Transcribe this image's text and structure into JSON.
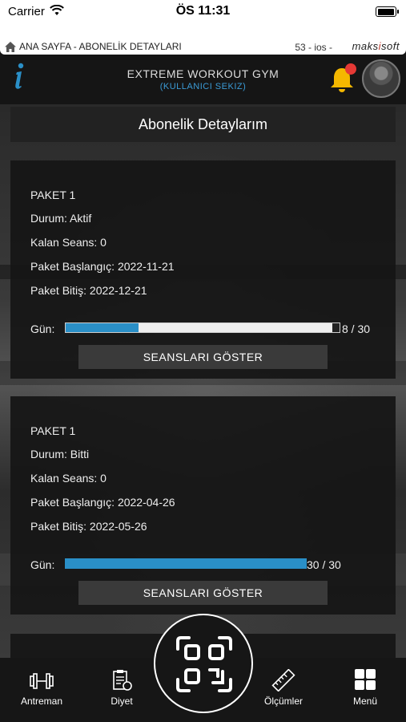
{
  "status_bar": {
    "carrier": "Carrier",
    "time": "ÖS 11:31"
  },
  "header": {
    "breadcrumb": "ANA SAYFA - ABONELİK DETAYLARI",
    "version": "53 - ios -",
    "brand_prefix": "maks",
    "brand_i": "i",
    "brand_suffix": "soft",
    "gym_name": "EXTREME WORKOUT GYM",
    "user_name": "(KULLANICI SEKIZ)"
  },
  "page": {
    "title": "Abonelik Detaylarım"
  },
  "packages": [
    {
      "name": "PAKET 1",
      "status": "Durum: Aktif",
      "remaining": "Kalan Seans: 0",
      "start": "Paket Başlangıç: 2022-11-21",
      "end": "Paket Bitiş: 2022-12-21",
      "gun_label": "Gün:",
      "progress": 0.267,
      "count": "8 / 30",
      "button": "SEANSLARI GÖSTER"
    },
    {
      "name": "PAKET 1",
      "status": "Durum: Bitti",
      "remaining": "Kalan Seans: 0",
      "start": "Paket Başlangıç: 2022-04-26",
      "end": "Paket Bitiş: 2022-05-26",
      "gun_label": "Gün:",
      "progress": 1.0,
      "count": "30 / 30",
      "button": "SEANSLARI GÖSTER"
    }
  ],
  "bottom_nav": {
    "antreman": "Antreman",
    "diyet": "Diyet",
    "olcumler": "Ölçümler",
    "menu": "Menü"
  },
  "colors": {
    "accent": "#2a8fc7",
    "notification": "#e53935",
    "bell": "#f5b800"
  }
}
